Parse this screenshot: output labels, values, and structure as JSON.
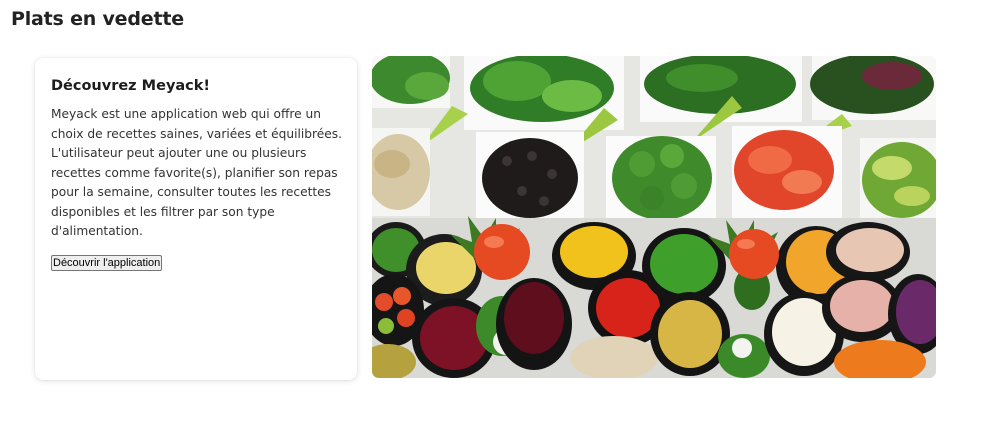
{
  "section": {
    "title": "Plats en vedette"
  },
  "card": {
    "title": "Découvrez Meyack!",
    "description": "Meyack est une application web qui offre un choix de recettes saines, variées et équilibrées. L'utilisateur peut ajouter une ou plusieurs recettes comme favorite(s), planifier son repas pour la semaine, consulter toutes les recettes disponibles et les filtrer par son type d'alimentation.",
    "button_label": "Découvrir l'application"
  },
  "image": {
    "subject": "salad-bar-vegetables-photo"
  },
  "colors": {
    "page_bg": "#ffffff",
    "card_bg": "#ffffff",
    "text": "#333333",
    "title": "#222222"
  }
}
